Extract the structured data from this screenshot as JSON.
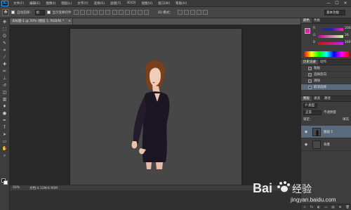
{
  "menubar": {
    "logo": "Ps",
    "items": [
      "文件(F)",
      "编辑(E)",
      "图像(I)",
      "图层(L)",
      "文字(Y)",
      "选择(S)",
      "滤镜(T)",
      "3D(D)",
      "视图(V)",
      "窗口(W)",
      "帮助(H)"
    ],
    "window_buttons": [
      "—",
      "☐",
      "✕"
    ]
  },
  "options": {
    "auto_select_label": "自动选择：",
    "auto_select_value": "组",
    "show_transform_label": "显示变换控件",
    "mode_label": "3D 模式：",
    "workspace_value": "基本功能"
  },
  "document": {
    "tab_title": "未标题-1 @ 50% (图层 1, RGB/8) *",
    "close": "×"
  },
  "status": {
    "zoom": "50%",
    "doc_info": "文档:4.12M/4.90M"
  },
  "panels": {
    "color_tabs": [
      "颜色",
      "色板"
    ],
    "sliders": [
      {
        "letter": "R",
        "value": "200",
        "color": "#ff3c3c"
      },
      {
        "letter": "G",
        "value": "26",
        "color": "#3cff3c"
      },
      {
        "letter": "B",
        "value": "160",
        "color": "#3c64ff"
      }
    ],
    "foreground_color": "#e91fb0",
    "history_tabs": [
      "历史记录",
      "动作"
    ],
    "history_items": [
      {
        "label": "粘贴",
        "selected": false
      },
      {
        "label": "选择反向",
        "selected": false
      },
      {
        "label": "清除",
        "selected": false
      },
      {
        "label": "取消选择",
        "selected": true
      }
    ],
    "layer_tabs": [
      "图层",
      "通道",
      "路径"
    ],
    "layer_filter": "P 类型",
    "blend_mode": "正常",
    "opacity_label": "不透明度",
    "lock_label": "锁定：",
    "fill_label": "填充",
    "layers": [
      {
        "name": "图层 1",
        "selected": true
      },
      {
        "name": "背景",
        "selected": false
      }
    ],
    "footer_icons": [
      "fx",
      "◐",
      "▭",
      "▤",
      "⊕",
      "🗑"
    ]
  },
  "watermark": {
    "brand": "Bai",
    "brand2": "经验",
    "url": "jingyan.baidu.com"
  }
}
